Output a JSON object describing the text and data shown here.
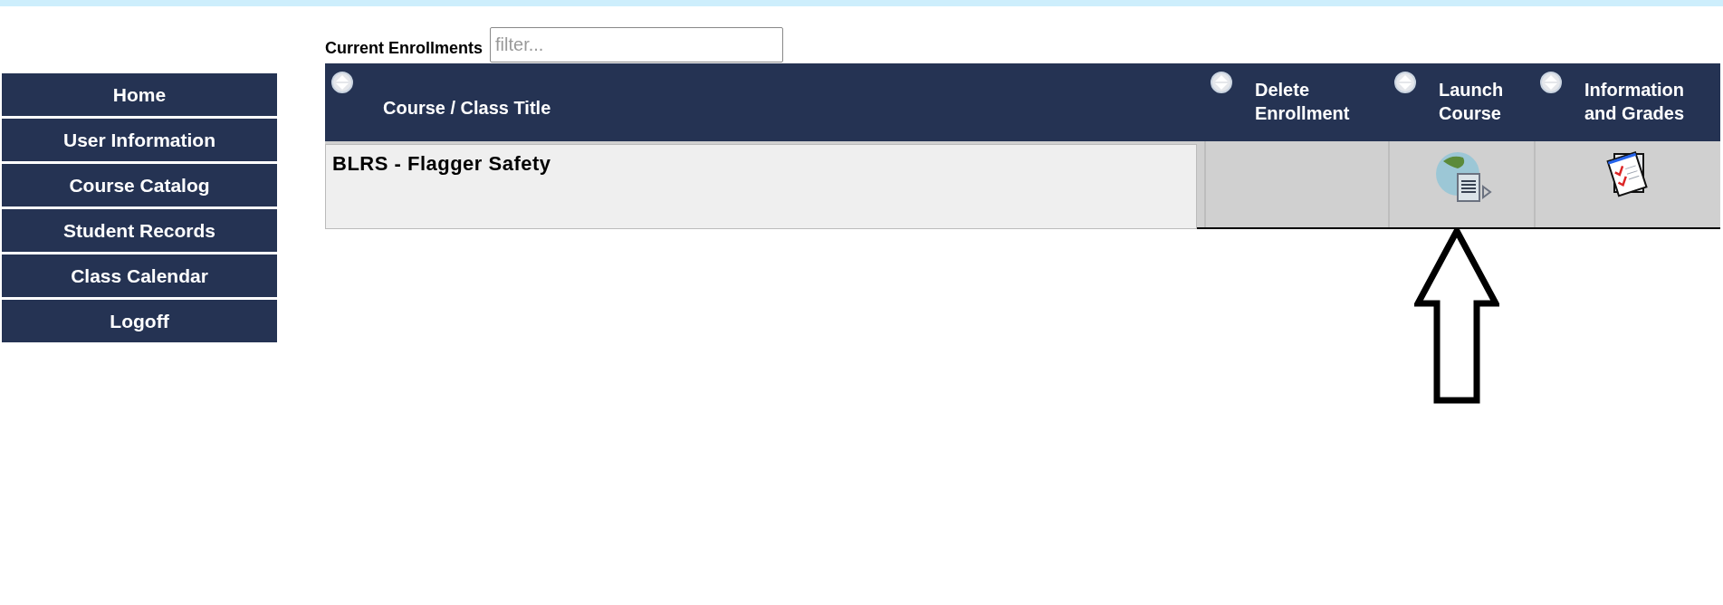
{
  "sidebar": {
    "items": [
      {
        "label": "Home"
      },
      {
        "label": "User Information"
      },
      {
        "label": "Course Catalog"
      },
      {
        "label": "Student Records"
      },
      {
        "label": "Class Calendar"
      },
      {
        "label": "Logoff"
      }
    ]
  },
  "enrollments": {
    "label": "Current Enrollments",
    "filter": {
      "placeholder": "filter..."
    },
    "columns": [
      {
        "label": "Course / Class Title"
      },
      {
        "label": "Delete Enrollment"
      },
      {
        "label": "Launch Course"
      },
      {
        "label": "Information and Grades"
      }
    ],
    "rows": [
      {
        "title": "BLRS - Flagger Safety"
      }
    ]
  }
}
